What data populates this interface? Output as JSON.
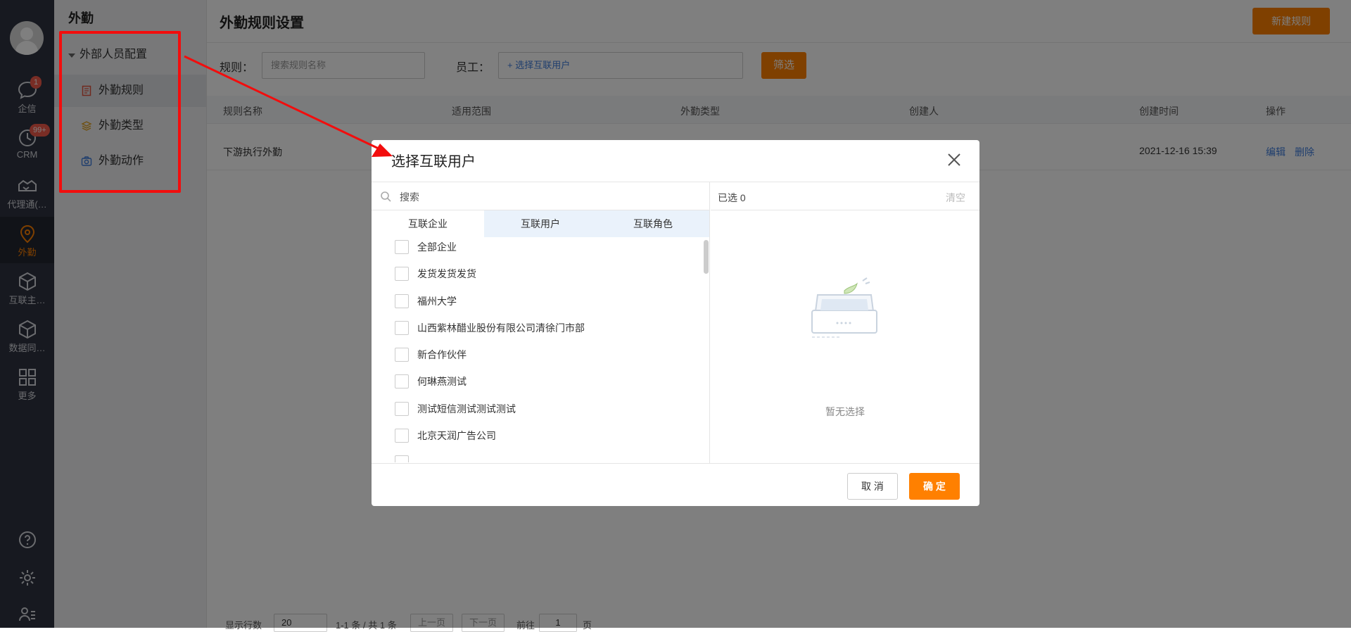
{
  "rail": {
    "items": [
      {
        "label": "企信",
        "badge": "1"
      },
      {
        "label": "CRM",
        "badge": "99+"
      },
      {
        "label": "代理通(…"
      },
      {
        "label": "外勤"
      },
      {
        "label": "互联主…"
      },
      {
        "label": "数据同…"
      },
      {
        "label": "更多"
      }
    ]
  },
  "subnav": {
    "title": "外勤",
    "group": "外部人员配置",
    "items": [
      "外勤规则",
      "外勤类型",
      "外勤动作"
    ]
  },
  "main": {
    "title": "外勤规则设置",
    "new_button": "新建规则",
    "filters": {
      "rule_label": "规则：",
      "rule_placeholder": "搜索规则名称",
      "employee_label": "员工：",
      "employee_link": "+ 选择互联用户",
      "filter_button": "筛选"
    },
    "table": {
      "headers": [
        "规则名称",
        "适用范围",
        "外勤类型",
        "创建人",
        "创建时间",
        "操作"
      ],
      "rows": [
        {
          "name": "下游执行外勤",
          "scope": "",
          "type": "",
          "creator": "",
          "created": "2021-12-16 15:39",
          "edit": "编辑",
          "delete": "删除"
        }
      ]
    },
    "footer": {
      "rows_label": "显示行数",
      "rows_value": "20",
      "summary": "1-1 条 / 共 1 条",
      "prev": "上一页",
      "next": "下一页",
      "goto": "前往",
      "page": "1",
      "page_unit": "页"
    }
  },
  "modal": {
    "title": "选择互联用户",
    "search_placeholder": "搜索",
    "tabs": [
      "互联企业",
      "互联用户",
      "互联角色"
    ],
    "list": [
      "全部企业",
      "发货发货发货",
      "福州大学",
      "山西紫林醋业股份有限公司清徐门市部",
      "新合作伙伴",
      "何琳燕测试",
      "测试短信测试测试测试",
      "北京天润广告公司"
    ],
    "selected_label": "已选 0",
    "clear_label": "清空",
    "empty_text": "暂无选择",
    "cancel": "取 消",
    "ok": "确 定"
  },
  "colors": {
    "accent": "#ff8000",
    "link": "#3f7ddc",
    "rail": "#2f3340",
    "annotation": "#f20d0d"
  }
}
